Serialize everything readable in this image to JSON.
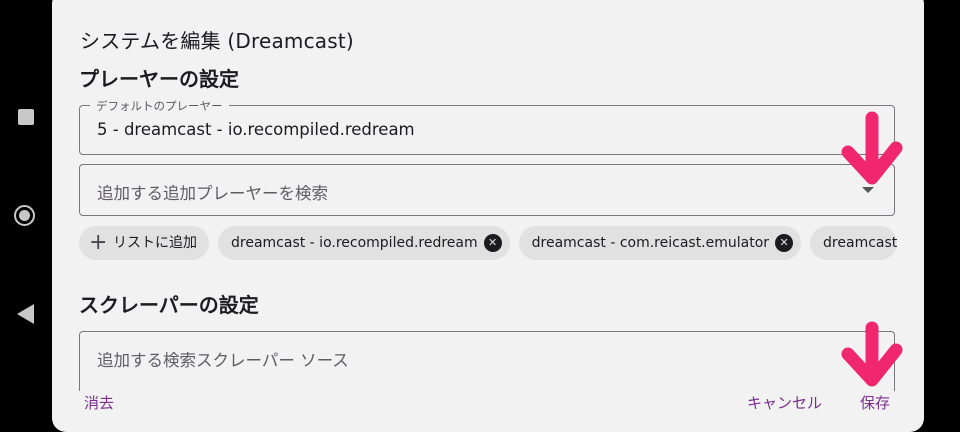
{
  "dialog": {
    "title": "システムを編集 (Dreamcast)",
    "player_section_title": "プレーヤーの設定",
    "default_player": {
      "label": "デフォルトのプレーヤー",
      "value": "5 - dreamcast - io.recompiled.redream"
    },
    "additional_player_search": {
      "placeholder": "追加する追加プレーヤーを検索"
    },
    "chips": {
      "add_label": "リストに追加",
      "items": [
        "dreamcast - io.recompiled.redream",
        "dreamcast - com.reicast.emulator",
        "dreamcast"
      ]
    },
    "scraper_section_title": "スクレーパーの設定",
    "scraper_search": {
      "placeholder": "追加する検索スクレーパー ソース"
    },
    "actions": {
      "clear": "消去",
      "cancel": "キャンセル",
      "save": "保存"
    }
  },
  "colors": {
    "accent": "#7b2e8e",
    "annotation_arrow": "#f0266f",
    "dialog_bg": "#f2f2f2"
  },
  "icons": {
    "add": "plus-icon",
    "remove_chip": "close-circle-icon",
    "dropdown": "dropdown-arrow-icon",
    "annotation": "down-arrow-annotation"
  }
}
